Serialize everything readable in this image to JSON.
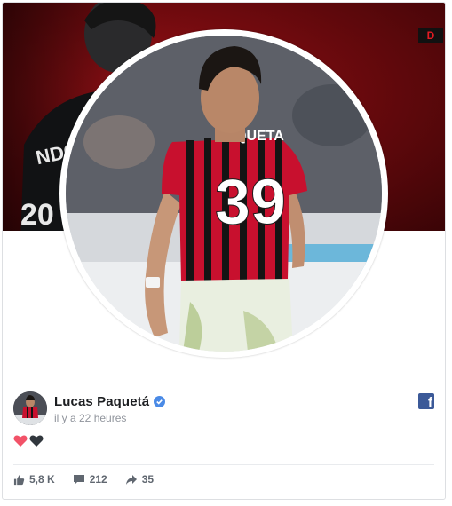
{
  "post": {
    "author_name": "Lucas Paquetá",
    "timestamp": "il y a 22 heures",
    "cover_badge": "D",
    "jersey_name": "PAQUETA",
    "jersey_number": "39",
    "cover_jersey_number": "20",
    "cover_jersey_name": "NDG"
  },
  "reactions": [
    "heart-icon",
    "black-heart-icon"
  ],
  "stats": {
    "likes": "5,8 K",
    "comments": "212",
    "shares": "35"
  },
  "colors": {
    "cover_red": "#9a1116",
    "facebook_blue": "#3b5998",
    "verified_blue": "#4a8ae6",
    "heart_pink": "#f25268"
  }
}
